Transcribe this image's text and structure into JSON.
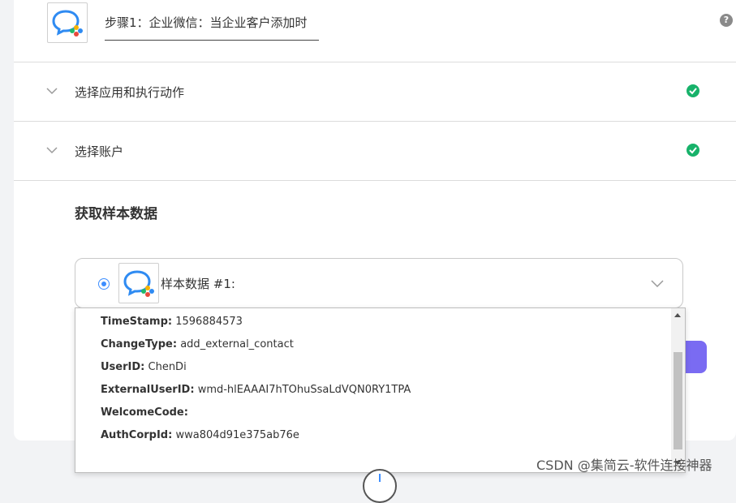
{
  "step": {
    "title": "步骤1：企业微信：当企业客户添加时",
    "help_icon": "?"
  },
  "sections": [
    {
      "label": "选择应用和执行动作",
      "status": "completed"
    },
    {
      "label": "选择账户",
      "status": "completed"
    }
  ],
  "sample": {
    "heading": "获取样本数据",
    "selected_label": "样本数据 #1:",
    "fields": [
      {
        "key": "TimeStamp:",
        "value": "1596884573"
      },
      {
        "key": "ChangeType:",
        "value": "add_external_contact"
      },
      {
        "key": "UserID:",
        "value": "ChenDi"
      },
      {
        "key": "ExternalUserID:",
        "value": "wmd-hlEAAAI7hTOhuSsaLdVQN0RY1TPA"
      },
      {
        "key": "WelcomeCode:",
        "value": ""
      },
      {
        "key": "AuthCorpId:",
        "value": "wwa804d91e375ab76e"
      }
    ]
  },
  "watermark": "CSDN @集简云-软件连接神器",
  "colors": {
    "accent_blue": "#3d8eff",
    "success_green": "#17b26a",
    "button_purple": "#7a6bf2"
  },
  "icons": {
    "app_logo": "wecom-logo-icon",
    "section_toggle": "chevron-down-icon",
    "status": "check-circle-icon"
  }
}
